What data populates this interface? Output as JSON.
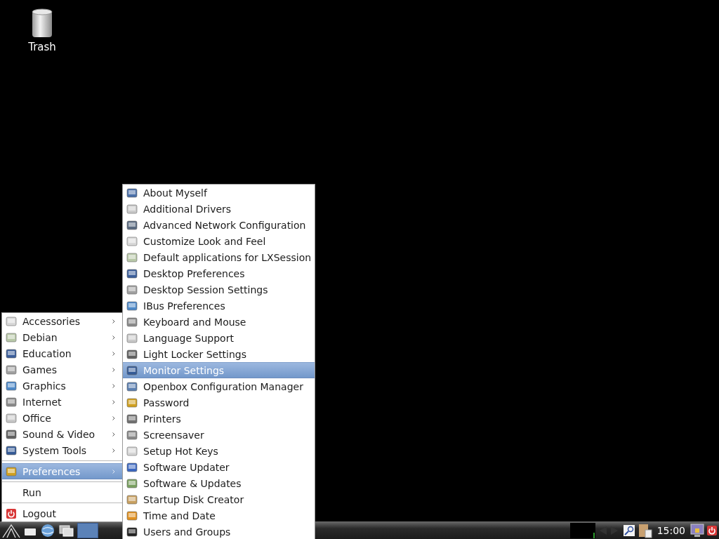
{
  "desktop": {
    "icons": [
      {
        "label": "Trash"
      }
    ]
  },
  "main_menu": {
    "items": [
      {
        "kind": "category",
        "label": "Accessories",
        "selected": false
      },
      {
        "kind": "category",
        "label": "Debian",
        "selected": false
      },
      {
        "kind": "category",
        "label": "Education",
        "selected": false
      },
      {
        "kind": "category",
        "label": "Games",
        "selected": false
      },
      {
        "kind": "category",
        "label": "Graphics",
        "selected": false
      },
      {
        "kind": "category",
        "label": "Internet",
        "selected": false
      },
      {
        "kind": "category",
        "label": "Office",
        "selected": false
      },
      {
        "kind": "category",
        "label": "Sound & Video",
        "selected": false
      },
      {
        "kind": "category",
        "label": "System Tools",
        "selected": false
      },
      {
        "kind": "separator"
      },
      {
        "kind": "category",
        "label": "Preferences",
        "selected": true
      },
      {
        "kind": "separator"
      },
      {
        "kind": "command",
        "label": "Run",
        "selected": false
      },
      {
        "kind": "separator"
      },
      {
        "kind": "logout",
        "label": "Logout",
        "selected": false
      }
    ]
  },
  "submenu": {
    "items": [
      {
        "label": "About Myself",
        "selected": false
      },
      {
        "label": "Additional Drivers",
        "selected": false
      },
      {
        "label": "Advanced Network Configuration",
        "selected": false
      },
      {
        "label": "Customize Look and Feel",
        "selected": false
      },
      {
        "label": "Default applications for LXSession",
        "selected": false
      },
      {
        "label": "Desktop Preferences",
        "selected": false
      },
      {
        "label": "Desktop Session Settings",
        "selected": false
      },
      {
        "label": "IBus Preferences",
        "selected": false
      },
      {
        "label": "Keyboard and Mouse",
        "selected": false
      },
      {
        "label": "Language Support",
        "selected": false
      },
      {
        "label": "Light Locker Settings",
        "selected": false
      },
      {
        "label": "Monitor Settings",
        "selected": true
      },
      {
        "label": "Openbox Configuration Manager",
        "selected": false
      },
      {
        "label": "Password",
        "selected": false
      },
      {
        "label": "Printers",
        "selected": false
      },
      {
        "label": "Screensaver",
        "selected": false
      },
      {
        "label": "Setup Hot Keys",
        "selected": false
      },
      {
        "label": "Software Updater",
        "selected": false
      },
      {
        "label": "Software & Updates",
        "selected": false
      },
      {
        "label": "Startup Disk Creator",
        "selected": false
      },
      {
        "label": "Time and Date",
        "selected": false
      },
      {
        "label": "Users and Groups",
        "selected": false
      }
    ]
  },
  "taskbar": {
    "clock": "15:00"
  }
}
